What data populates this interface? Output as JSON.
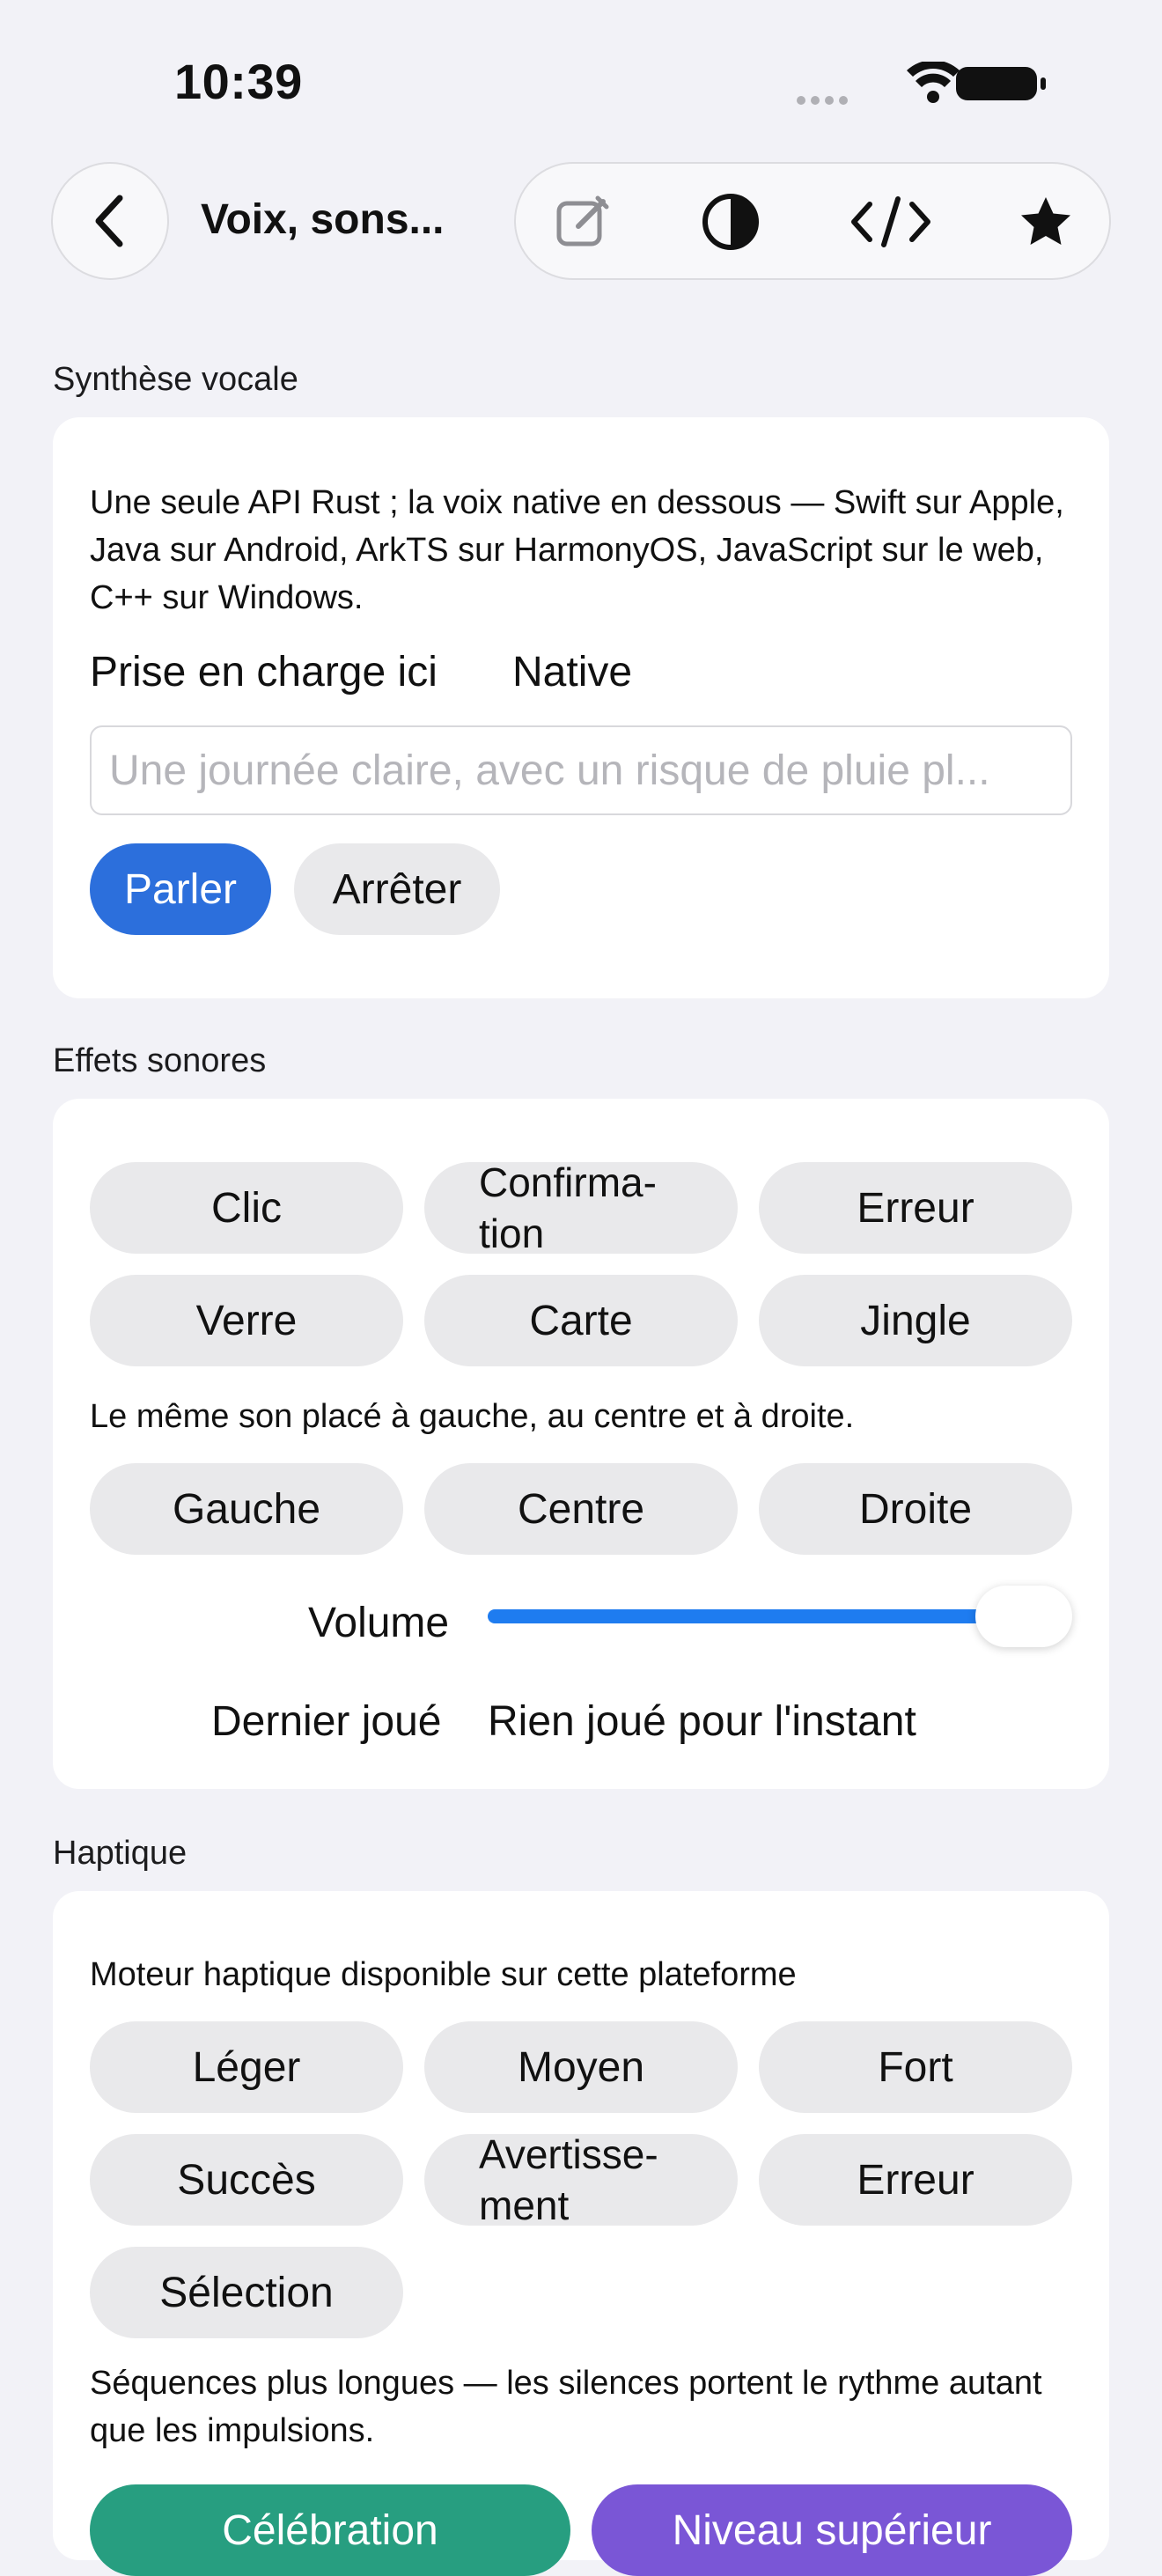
{
  "status_bar": {
    "time": "10:39"
  },
  "nav": {
    "title": "Voix, sons...",
    "icons": [
      "back-chevron-icon",
      "edit-icon",
      "contrast-icon",
      "code-icon",
      "star-icon"
    ]
  },
  "tts": {
    "header": "Synthèse vocale",
    "description": "Une seule API Rust ; la voix native en dessous — Swift sur Apple, Java sur Android, ArkTS sur HarmonyOS, JavaScript sur le web, C++ sur Windows.",
    "support_label": "Prise en charge ici",
    "support_value": "Native",
    "input_placeholder": "Une journée claire, avec un risque de pluie pl...",
    "speak_label": "Parler",
    "stop_label": "Arrêter"
  },
  "sfx": {
    "header": "Effets sonores",
    "sounds": [
      "Clic",
      "Confirma-\ntion",
      "Erreur",
      "Verre",
      "Carte",
      "Jingle"
    ],
    "pan_caption": "Le même son placé à gauche, au centre et à droite.",
    "pan_buttons": [
      "Gauche",
      "Centre",
      "Droite"
    ],
    "volume_label": "Volume",
    "volume_value": 1.0,
    "last_played_label": "Dernier joué",
    "last_played_value": "Rien joué pour l'instant"
  },
  "haptics": {
    "header": "Haptique",
    "caption": "Moteur haptique disponible sur cette plateforme",
    "buttons": [
      "Léger",
      "Moyen",
      "Fort",
      "Succès",
      "Avertisse-\nment",
      "Erreur",
      "Sélection"
    ],
    "sequence_caption": "Séquences plus longues — les silences portent le rythme autant que les impulsions.",
    "sequence_buttons": [
      "Célébration",
      "Niveau supérieur"
    ]
  },
  "colors": {
    "accent_blue": "#2c6fdc",
    "slider_blue": "#1e7cf0",
    "green": "#279e80",
    "purple": "#7a56d6",
    "background": "#f2f2f7"
  }
}
